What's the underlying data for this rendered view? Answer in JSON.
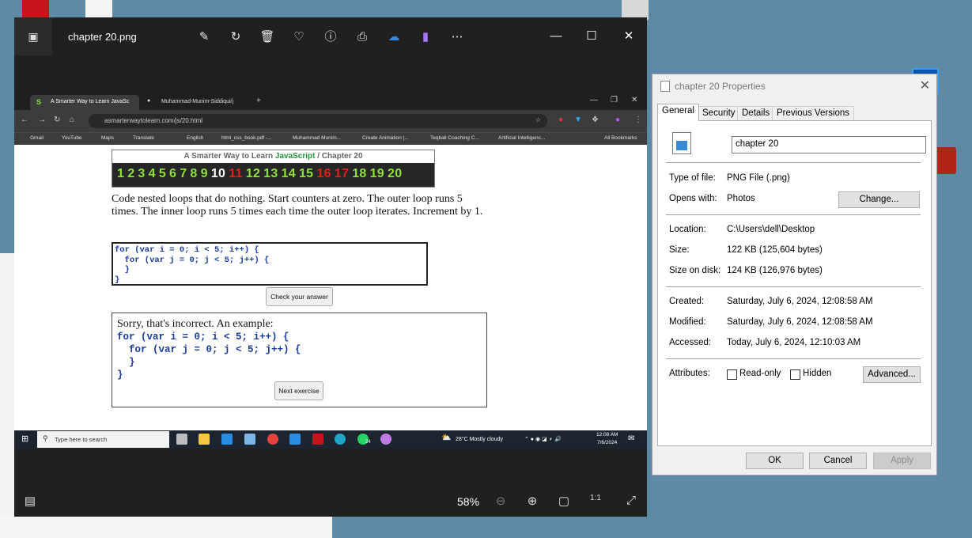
{
  "photos": {
    "title": "chapter 20.png",
    "zoom": "58%",
    "tool_icons": [
      "edit-image-icon",
      "rotate-icon",
      "delete-icon",
      "favorite-icon",
      "info-icon",
      "print-icon",
      "onedrive-icon",
      "clipchamp-icon",
      "more-icon"
    ]
  },
  "browser": {
    "tabs": [
      "A Smarter Way to Learn JavaSc",
      "Muhammad-Munim-Siddiqui/j"
    ],
    "url": "asmarterwaytolearn.com/js/20.html",
    "bookmarks": [
      "Gmail",
      "YouTube",
      "Maps",
      "Translate",
      "English",
      "html_css_book.pdf -...",
      "Muhammad Munim...",
      "Create Animation |...",
      "Teqball Coaching C...",
      "Artificial Intelligenc...",
      "All Bookmarks"
    ]
  },
  "lesson": {
    "header_prefix": "A Smarter Way to Learn ",
    "header_js": "JavaScript",
    "header_suffix": "  /  Chapter 20",
    "chapters": [
      {
        "n": "1",
        "c": "g"
      },
      {
        "n": "2",
        "c": "g"
      },
      {
        "n": "3",
        "c": "g"
      },
      {
        "n": "4",
        "c": "g"
      },
      {
        "n": "5",
        "c": "g"
      },
      {
        "n": "6",
        "c": "g"
      },
      {
        "n": "7",
        "c": "g"
      },
      {
        "n": "8",
        "c": "g"
      },
      {
        "n": "9",
        "c": "g"
      },
      {
        "n": "10",
        "c": "w"
      },
      {
        "n": "11",
        "c": "r"
      },
      {
        "n": "12",
        "c": "g"
      },
      {
        "n": "13",
        "c": "g"
      },
      {
        "n": "14",
        "c": "g"
      },
      {
        "n": "15",
        "c": "g"
      },
      {
        "n": "16",
        "c": "r"
      },
      {
        "n": "17",
        "c": "r"
      },
      {
        "n": "18",
        "c": "g"
      },
      {
        "n": "19",
        "c": "g"
      },
      {
        "n": "20",
        "c": "g"
      }
    ],
    "instructions": "Code nested loops that do nothing. Start counters at zero. The outer loop runs 5 times. The inner loop runs 5 times each time the outer loop iterates. Increment by 1.",
    "user_code": "for (var i = 0; i < 5; i++) {\n  for (var j = 0; j < 5; j++) {\n  }\n}",
    "check_button": "Check your answer",
    "result_message": "Sorry, that's incorrect. An example:",
    "example_code": "for (var i = 0; i < 5; i++) {\n  for (var j = 0; j < 5; j++) {\n  }\n}",
    "next_button": "Next exercise"
  },
  "taskbar": {
    "search_placeholder": "Type here to search",
    "weather": "28°C  Mostly cloudy",
    "time": "12:08 AM",
    "date": "7/6/2024",
    "whatsapp_badge": "24"
  },
  "properties": {
    "title": "chapter 20 Properties",
    "tabs": [
      "General",
      "Security",
      "Details",
      "Previous Versions"
    ],
    "filename": "chapter 20",
    "type_label": "Type of file:",
    "type_value": "PNG File (.png)",
    "opens_label": "Opens with:",
    "opens_value": "Photos",
    "change_button": "Change...",
    "location_label": "Location:",
    "location_value": "C:\\Users\\dell\\Desktop",
    "size_label": "Size:",
    "size_value": "122 KB (125,604 bytes)",
    "disk_label": "Size on disk:",
    "disk_value": "124 KB (126,976 bytes)",
    "created_label": "Created:",
    "created_value": "Saturday, July 6, 2024, 12:08:58 AM",
    "modified_label": "Modified:",
    "modified_value": "Saturday, July 6, 2024, 12:08:58 AM",
    "accessed_label": "Accessed:",
    "accessed_value": "Today, July 6, 2024, 12:10:03 AM",
    "attributes_label": "Attributes:",
    "readonly_label": "Read-only",
    "hidden_label": "Hidden",
    "advanced_button": "Advanced...",
    "ok_button": "OK",
    "cancel_button": "Cancel",
    "apply_button": "Apply"
  }
}
